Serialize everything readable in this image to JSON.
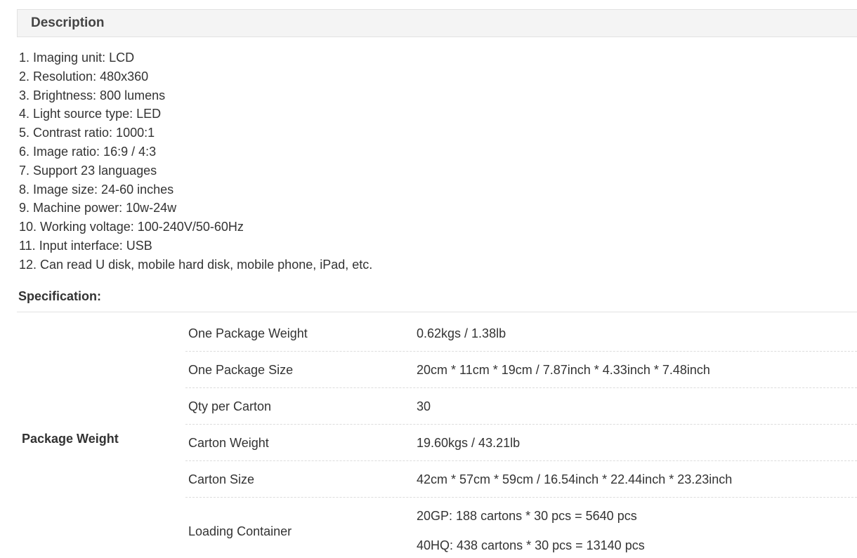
{
  "description": {
    "title": "Description",
    "items": [
      "1. Imaging unit: LCD",
      "2. Resolution: 480x360",
      "3. Brightness: 800 lumens",
      "4. Light source type: LED",
      "5. Contrast ratio: 1000:1",
      "6. Image ratio: 16:9 / 4:3",
      "7. Support 23 languages",
      "8. Image size: 24-60 inches",
      "9. Machine power: 10w-24w",
      "10. Working voltage: 100-240V/50-60Hz",
      "11. Input interface: USB",
      "12. Can read U disk, mobile hard disk, mobile phone, iPad, etc."
    ]
  },
  "specification": {
    "title": "Specification:",
    "group_label": "Package Weight",
    "rows": [
      {
        "key": "One Package Weight",
        "value": "0.62kgs / 1.38lb"
      },
      {
        "key": "One Package Size",
        "value": "20cm * 11cm * 19cm / 7.87inch * 4.33inch * 7.48inch"
      },
      {
        "key": "Qty per Carton",
        "value": "30"
      },
      {
        "key": "Carton Weight",
        "value": "19.60kgs / 43.21lb"
      },
      {
        "key": "Carton Size",
        "value": "42cm * 57cm * 59cm / 16.54inch * 22.44inch * 23.23inch"
      },
      {
        "key": "Loading Container",
        "values": [
          "20GP: 188 cartons * 30 pcs = 5640 pcs",
          "40HQ: 438 cartons * 30 pcs = 13140 pcs"
        ]
      }
    ]
  }
}
